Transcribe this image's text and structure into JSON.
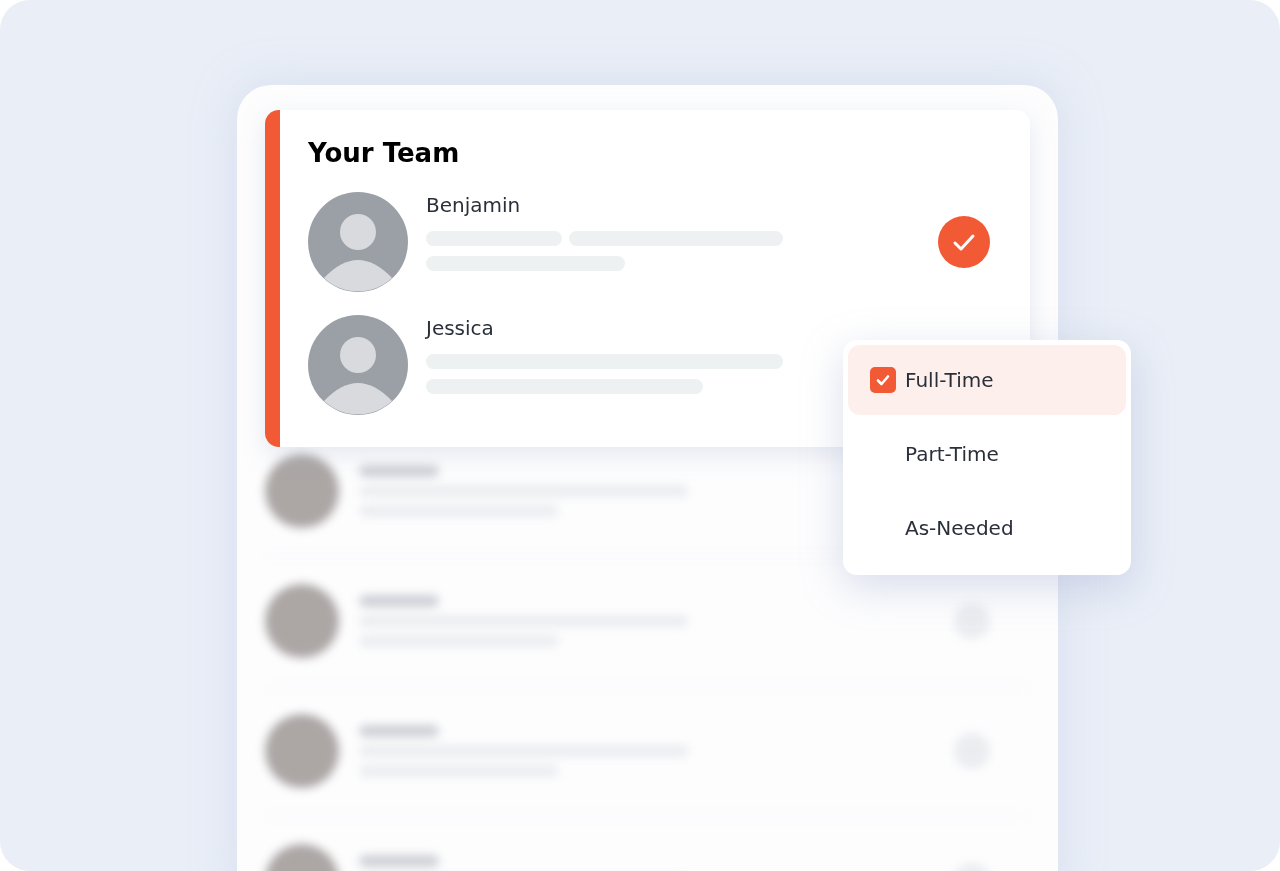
{
  "team_card": {
    "title": "Your Team",
    "members": [
      {
        "name": "Benjamin",
        "selected": true
      },
      {
        "name": "Jessica",
        "selected": false
      }
    ]
  },
  "employment_menu": {
    "options": [
      {
        "label": "Full-Time",
        "selected": true
      },
      {
        "label": "Part-Time",
        "selected": false
      },
      {
        "label": "As-Needed",
        "selected": false
      }
    ]
  }
}
